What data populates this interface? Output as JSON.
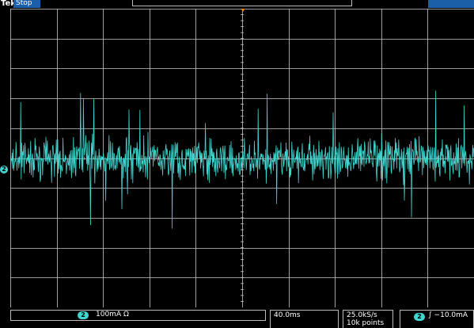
{
  "header": {
    "brand": "Tek",
    "run_state": "Stop"
  },
  "channel": {
    "number": "2",
    "scale": "100mA Ω",
    "color": "#3fd6d0"
  },
  "timebase": {
    "scale": "40.0ms"
  },
  "acquisition": {
    "sample_rate": "25.0kS/s",
    "record_length": "10k points"
  },
  "trigger": {
    "source": "2",
    "slope_level": "∫ −10.0mA"
  },
  "display": {
    "grid_color": "#c8c8c8",
    "trace_color": "#3fd6d0",
    "accent_trigger_color": "#ff8c00"
  }
}
